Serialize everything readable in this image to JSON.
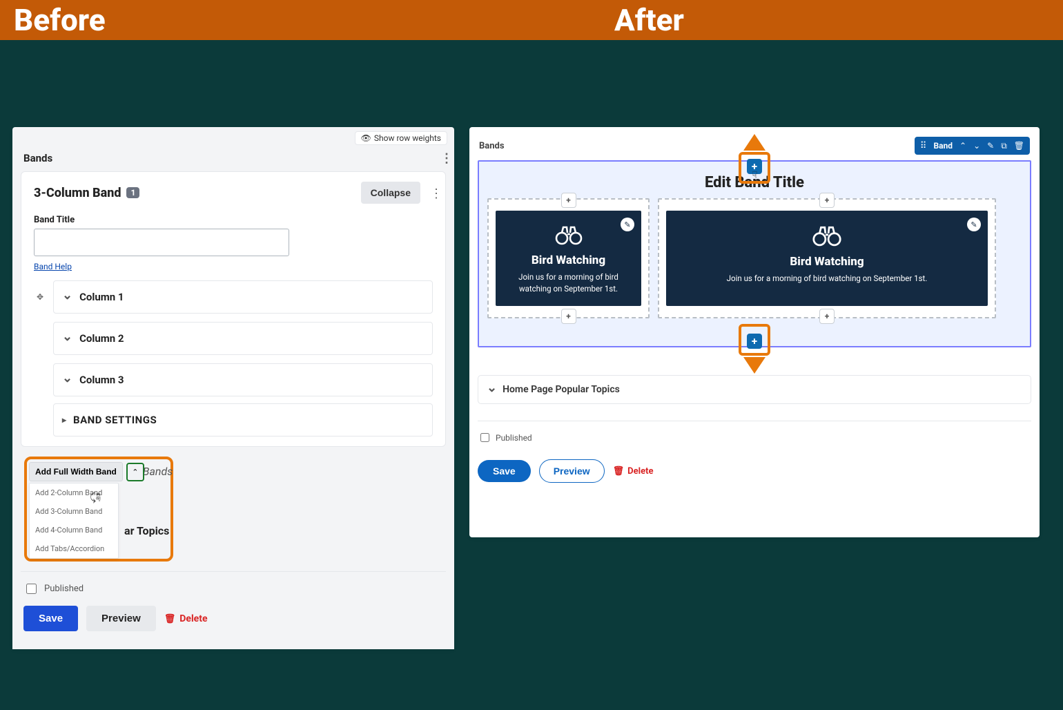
{
  "header": {
    "before": "Before",
    "after": "After"
  },
  "left": {
    "show_row_weights": "Show row weights",
    "bands_label": "Bands",
    "card_title": "3-Column Band",
    "card_badge": "1",
    "collapse": "Collapse",
    "band_title_label": "Band Title",
    "band_title_value": "",
    "band_help": "Band Help",
    "columns": [
      "Column 1",
      "Column 2",
      "Column 3"
    ],
    "settings": "BAND SETTINGS",
    "add_full": "Add Full Width Band",
    "behind_bands_text": "o Bands",
    "dropdown": [
      "Add 2-Column Band",
      "Add 3-Column Band",
      "Add 4-Column Band",
      "Add Tabs/Accordion"
    ],
    "behind_topics_text": "ar Topics",
    "published": "Published",
    "save": "Save",
    "preview": "Preview",
    "delete": "Delete"
  },
  "right": {
    "bands_label": "Bands",
    "toolbar_label": "Band",
    "editor_title": "Edit Band Title",
    "card_title": "Bird Watching",
    "card_sub_short": "Join us for a morning of bird watching on September 1st.",
    "card_sub_long": "Join us for a morning of bird watching on September 1st.",
    "topics": "Home Page Popular Topics",
    "published": "Published",
    "save": "Save",
    "preview": "Preview",
    "delete": "Delete"
  }
}
